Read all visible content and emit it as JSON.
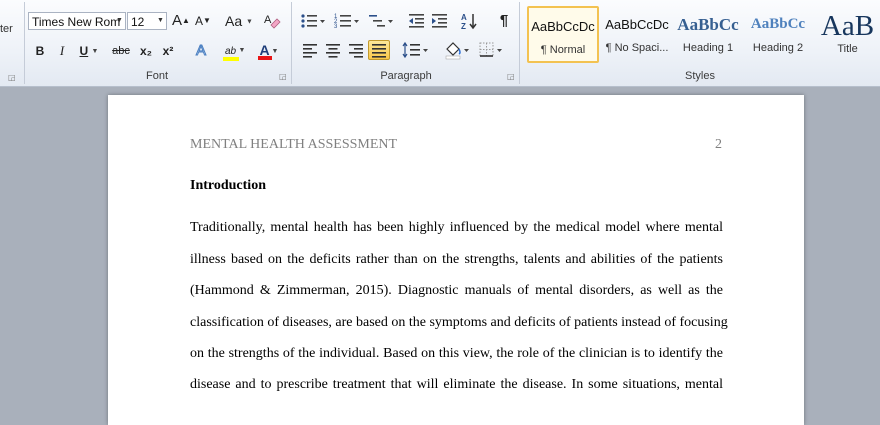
{
  "ribbon": {
    "clipboard": {
      "label_fragment": "ter"
    },
    "font": {
      "font_name": "Times New Rom",
      "font_size": "12",
      "grow_label": "A",
      "shrink_label": "A",
      "change_case_label": "Aa",
      "bold_label": "B",
      "italic_label": "I",
      "underline_label": "U",
      "strike_label": "abc",
      "subscript_label": "x₂",
      "superscript_label": "x²",
      "highlight_label": "ab",
      "font_color_label": "A",
      "group_label": "Font",
      "highlight_color": "#ffff00",
      "font_color": "#e81416"
    },
    "paragraph": {
      "group_label": "Paragraph"
    },
    "styles": {
      "group_label": "Styles",
      "items": [
        {
          "sample": "AaBbCcDc",
          "name": "¶ Normal"
        },
        {
          "sample": "AaBbCcDc",
          "name": "¶ No Spaci..."
        },
        {
          "sample": "AaBbCc",
          "name": "Heading 1"
        },
        {
          "sample": "AaBbCc",
          "name": "Heading 2"
        },
        {
          "sample": "AaB",
          "name": "Title"
        }
      ]
    }
  },
  "document": {
    "running_head": "MENTAL HEALTH ASSESSMENT",
    "page_number": "2",
    "heading": "Introduction",
    "lines": [
      "Traditionally, mental health has been highly influenced by the medical model where mental",
      "illness based on the deficits rather than on the strengths, talents and abilities of the patients",
      "(Hammond & Zimmerman, 2015). Diagnostic manuals of mental disorders, as well as the",
      "classification of diseases, are based on the symptoms and deficits of patients instead of focusing",
      "on the strengths of the individual. Based on this view, the role of the clinician is to identify the",
      "disease and to prescribe treatment that will eliminate the disease. In some situations, mental"
    ]
  }
}
